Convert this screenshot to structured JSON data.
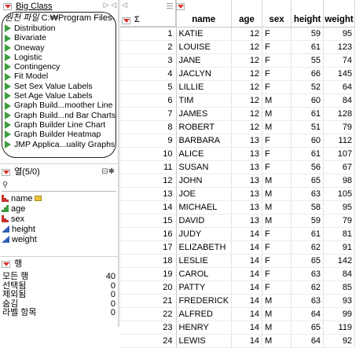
{
  "tables_panel": {
    "title": "Big Class",
    "nav_arrows": "▷ ◁",
    "source_label": "원천 파일",
    "source_path": "C:₩Program Files₩",
    "scripts": [
      "Distribution",
      "Bivariate",
      "Oneway",
      "Logistic",
      "Contingency",
      "Fit Model",
      "Set Sex Value Labels",
      "Set Age Value Labels",
      "Graph Build...moother Line",
      "Graph Build...nd Bar Charts",
      "Graph Builder Line Chart",
      "Graph Builder Heatmap",
      "JMP Applica...uality Graphs"
    ]
  },
  "columns_panel": {
    "title": "열(5/0)",
    "search_icon": "search-icon",
    "columns": [
      {
        "name": "name",
        "type": "nominal",
        "key": true
      },
      {
        "name": "age",
        "type": "ordinal"
      },
      {
        "name": "sex",
        "type": "nominal"
      },
      {
        "name": "height",
        "type": "continuous"
      },
      {
        "name": "weight",
        "type": "continuous"
      }
    ]
  },
  "rows_panel": {
    "title": "행",
    "stats": [
      {
        "label": "모든 행",
        "value": "40"
      },
      {
        "label": "선택됨",
        "value": "0"
      },
      {
        "label": "제외됨",
        "value": "0"
      },
      {
        "label": "숨김",
        "value": "0"
      },
      {
        "label": "라벨 항목",
        "value": "0"
      }
    ]
  },
  "grid": {
    "corner_sigma": "Σ",
    "headers": [
      "name",
      "age",
      "sex",
      "height",
      "weight"
    ],
    "rows": [
      [
        "1",
        "KATIE",
        "12",
        "F",
        "59",
        "95"
      ],
      [
        "2",
        "LOUISE",
        "12",
        "F",
        "61",
        "123"
      ],
      [
        "3",
        "JANE",
        "12",
        "F",
        "55",
        "74"
      ],
      [
        "4",
        "JACLYN",
        "12",
        "F",
        "66",
        "145"
      ],
      [
        "5",
        "LILLIE",
        "12",
        "F",
        "52",
        "64"
      ],
      [
        "6",
        "TIM",
        "12",
        "M",
        "60",
        "84"
      ],
      [
        "7",
        "JAMES",
        "12",
        "M",
        "61",
        "128"
      ],
      [
        "8",
        "ROBERT",
        "12",
        "M",
        "51",
        "79"
      ],
      [
        "9",
        "BARBARA",
        "13",
        "F",
        "60",
        "112"
      ],
      [
        "10",
        "ALICE",
        "13",
        "F",
        "61",
        "107"
      ],
      [
        "11",
        "SUSAN",
        "13",
        "F",
        "56",
        "67"
      ],
      [
        "12",
        "JOHN",
        "13",
        "M",
        "65",
        "98"
      ],
      [
        "13",
        "JOE",
        "13",
        "M",
        "63",
        "105"
      ],
      [
        "14",
        "MICHAEL",
        "13",
        "M",
        "58",
        "95"
      ],
      [
        "15",
        "DAVID",
        "13",
        "M",
        "59",
        "79"
      ],
      [
        "16",
        "JUDY",
        "14",
        "F",
        "61",
        "81"
      ],
      [
        "17",
        "ELIZABETH",
        "14",
        "F",
        "62",
        "91"
      ],
      [
        "18",
        "LESLIE",
        "14",
        "F",
        "65",
        "142"
      ],
      [
        "19",
        "CAROL",
        "14",
        "F",
        "63",
        "84"
      ],
      [
        "20",
        "PATTY",
        "14",
        "F",
        "62",
        "85"
      ],
      [
        "21",
        "FREDERICK",
        "14",
        "M",
        "63",
        "93"
      ],
      [
        "22",
        "ALFRED",
        "14",
        "M",
        "64",
        "99"
      ],
      [
        "23",
        "HENRY",
        "14",
        "M",
        "65",
        "119"
      ],
      [
        "24",
        "LEWIS",
        "14",
        "M",
        "64",
        "92"
      ]
    ]
  },
  "colors": {
    "red_triangle": "#d9342b",
    "script_green": "#3f9d3c",
    "continuous_blue": "#2f5fb5"
  }
}
